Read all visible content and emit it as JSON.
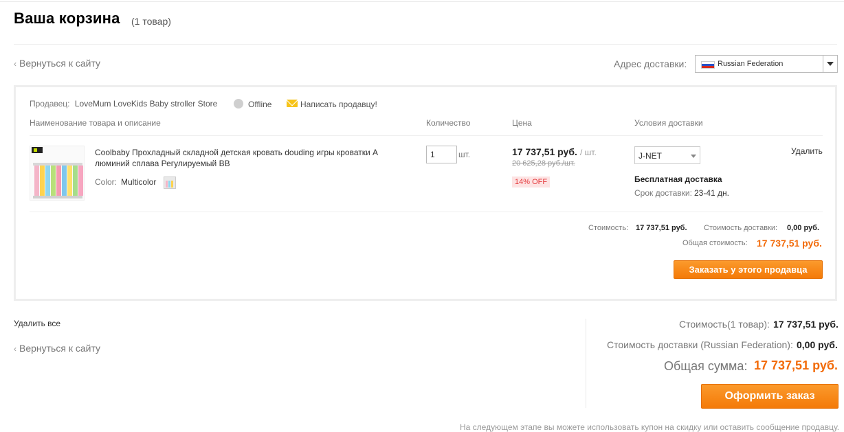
{
  "header": {
    "title": "Ваша корзина",
    "count": "(1 товар)"
  },
  "nav": {
    "back_link": "Вернуться к сайту",
    "back_link_bottom": "Вернуться к сайту"
  },
  "shipping_address": {
    "label": "Адрес доставки:",
    "country": "Russian Federation"
  },
  "store": {
    "seller_label": "Продавец:",
    "seller_name": "LoveMum LoveKids Baby stroller Store",
    "status": "Offline",
    "message_link": "Написать продавцу!",
    "columns": {
      "name": "Наименование товара и описание",
      "quantity": "Количество",
      "price": "Цена",
      "shipping": "Условия доставки"
    },
    "item": {
      "name": "Coolbaby Прохладный складной детская кровать douding игры кроватки А люминий сплава Регулируемый BB",
      "color_label": "Color:",
      "color_value": "Multicolor",
      "quantity": "1",
      "unit": "шт.",
      "price": "17 737,51 руб.",
      "price_per": "/ шт.",
      "old_price": "20 625,28 руб./шт.",
      "discount": "14% OFF",
      "shipping_method": "J-NET",
      "free_shipping": "Бесплатная доставка",
      "delivery_time_label": "Срок доставки:",
      "delivery_time": "23-41 дн.",
      "delete": "Удалить"
    },
    "summary": {
      "cost_label": "Стоимость:",
      "cost_value": "17 737,51 руб.",
      "shipping_label": "Стоимость доставки:",
      "shipping_value": "0,00 руб.",
      "total_label": "Общая стоимость:",
      "total_value": "17 737,51 руб."
    },
    "order_button": "Заказать у этого продавца"
  },
  "footer": {
    "delete_all": "Удалить все",
    "cost_label": "Стоимость(1 товар):",
    "cost_value": "17 737,51 руб.",
    "shipping_label": "Стоимость доставки (Russian Federation):",
    "shipping_value": "0,00 руб.",
    "grand_total_label": "Общая сумма:",
    "grand_total_value": "17 737,51 руб.",
    "checkout_button": "Оформить заказ",
    "note": "На следующем этапе вы можете использовать купон на скидку или оставить сообщение продавцу."
  },
  "colors": {
    "accent_orange": "#f26b0a",
    "button_orange": "#f47a08",
    "discount_red": "#e4393c"
  }
}
